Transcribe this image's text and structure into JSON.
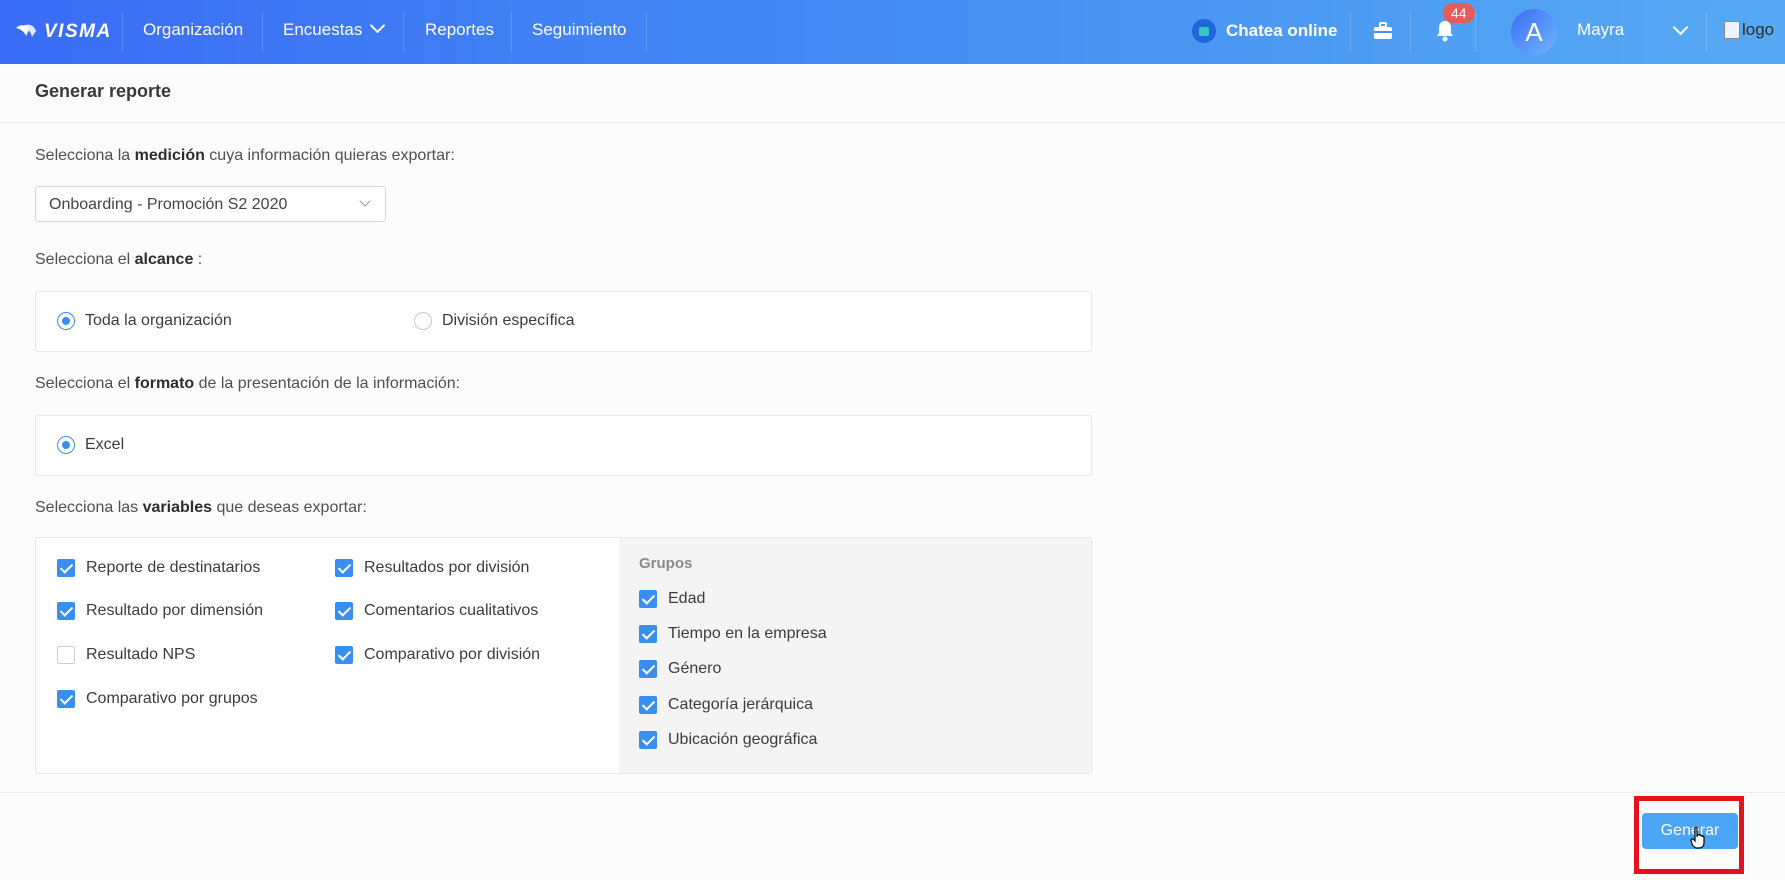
{
  "nav": {
    "brand": "VISMA",
    "items": [
      "Organización",
      "Encuestas",
      "Reportes",
      "Seguimiento"
    ],
    "chat_label": "Chatea online",
    "notifications_count": "44",
    "avatar_initial": "A",
    "user_name": "Mayra",
    "logo_alt": "logo"
  },
  "page": {
    "title": "Generar reporte"
  },
  "medicion": {
    "label_pre": "Selecciona la ",
    "label_bold": "medición",
    "label_post": " cuya información quieras exportar:",
    "selected": "Onboarding - Promoción S2 2020"
  },
  "alcance": {
    "label_pre": "Selecciona el ",
    "label_bold": "alcance",
    "label_post": " :",
    "options": [
      "Toda la organización",
      "División específica"
    ],
    "selected": "Toda la organización"
  },
  "formato": {
    "label_pre": "Selecciona el ",
    "label_bold": "formato",
    "label_post": " de la presentación de la información:",
    "options": [
      "Excel"
    ],
    "selected": "Excel"
  },
  "variables": {
    "label_pre": "Selecciona las ",
    "label_bold": "variables",
    "label_post": " que deseas exportar:",
    "items": [
      {
        "label": "Reporte de destinatarios",
        "checked": true
      },
      {
        "label": "Resultado por dimensión",
        "checked": true
      },
      {
        "label": "Resultado NPS",
        "checked": false
      },
      {
        "label": "Comparativo por grupos",
        "checked": true
      },
      {
        "label": "Resultados por división",
        "checked": true
      },
      {
        "label": "Comentarios cualitativos",
        "checked": true
      },
      {
        "label": "Comparativo por división",
        "checked": true
      }
    ],
    "groups_title": "Grupos",
    "groups": [
      {
        "label": "Edad",
        "checked": true
      },
      {
        "label": "Tiempo en la empresa",
        "checked": true
      },
      {
        "label": "Género",
        "checked": true
      },
      {
        "label": "Categoría jerárquica",
        "checked": true
      },
      {
        "label": "Ubicación geográfica",
        "checked": true
      }
    ]
  },
  "footer": {
    "generate_label": "Generar"
  },
  "colors": {
    "primary": "#3a8ef0",
    "button": "#4aa6f5",
    "highlight": "#e3121b",
    "badge": "#e85b5b"
  }
}
